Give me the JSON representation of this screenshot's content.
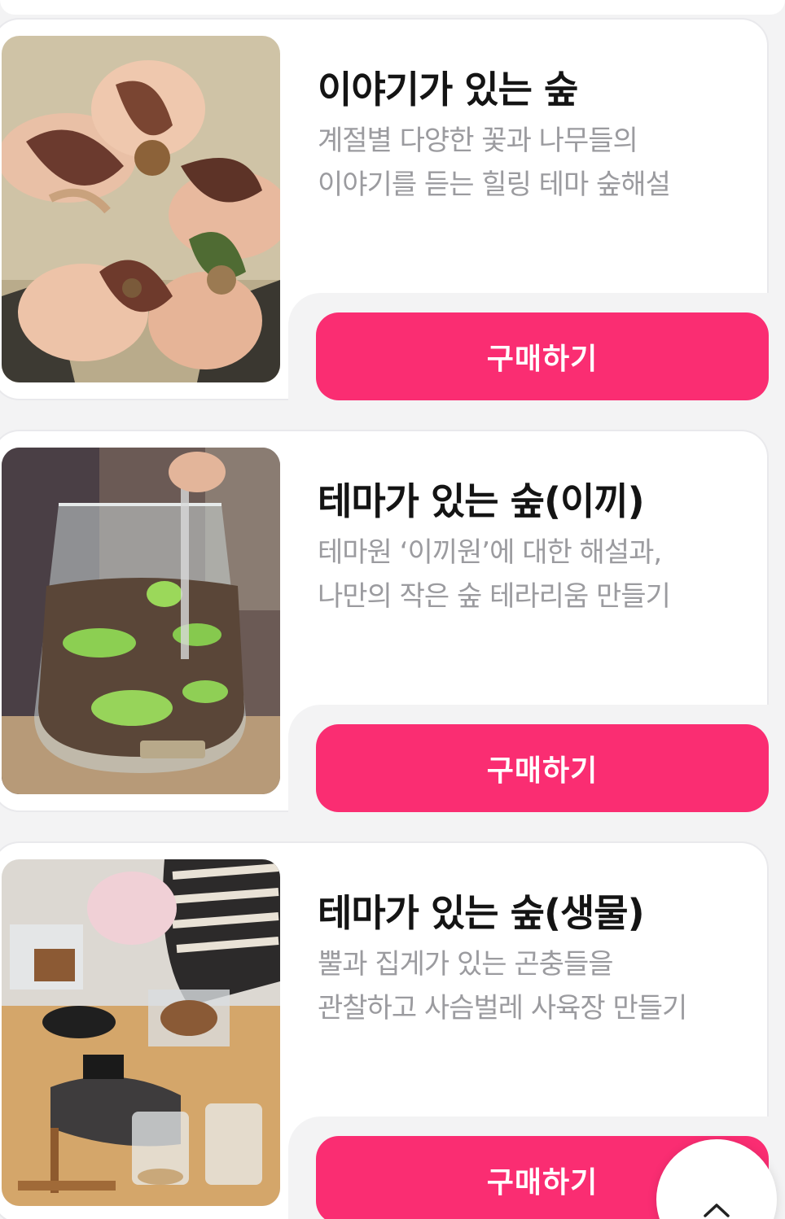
{
  "products": [
    {
      "title": "이야기가 있는 숲",
      "desc": [
        "계절별 다양한 꽃과 나무들의",
        "이야기를 듣는 힐링 테마 숲해설"
      ],
      "buy_label": "구매하기",
      "image_icon": "leaves-in-hands-photo"
    },
    {
      "title": "테마가 있는 숲(이끼)",
      "desc": [
        "테마원 ‘이끼원’에 대한 해설과,",
        "나만의 작은 숲 테라리움 만들기"
      ],
      "buy_label": "구매하기",
      "image_icon": "moss-terrarium-photo"
    },
    {
      "title": "테마가 있는 숲(생물)",
      "desc": [
        "뿔과 집게가 있는 곤충들을",
        "관찰하고 사슴벌레 사육장 만들기"
      ],
      "buy_label": "구매하기",
      "image_icon": "insect-habitat-workshop-photo"
    }
  ],
  "scroll_top": {
    "icon": "chevron-up-icon"
  },
  "colors": {
    "accent": "#fa2d72",
    "title": "#141414",
    "desc": "#9b9b9f",
    "background": "#f3f3f4"
  }
}
